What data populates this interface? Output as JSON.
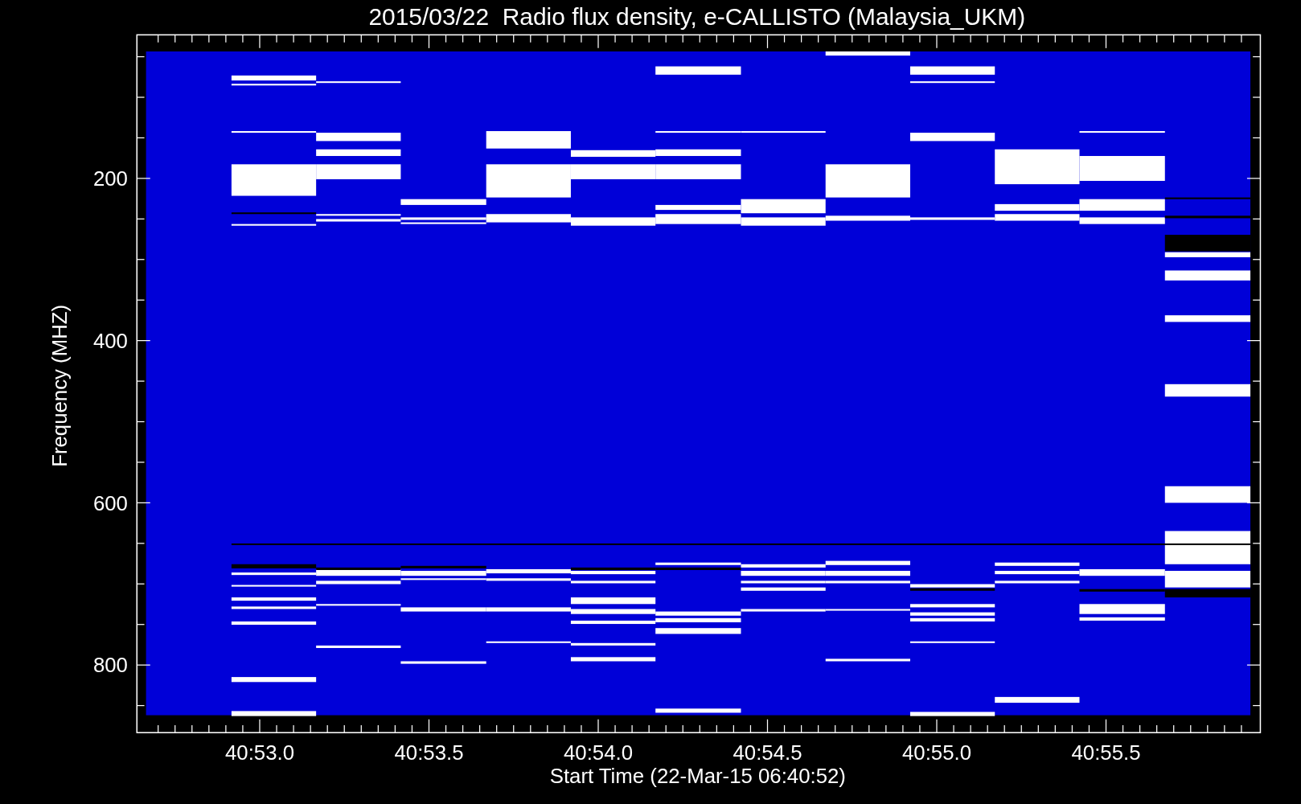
{
  "title": "2015/03/22  Radio flux density, e-CALLISTO (Malaysia_UKM)",
  "xlabel": "Start Time (22-Mar-15 06:40:52)",
  "ylabel": "Frequency (MHZ)",
  "yticks": [
    "200",
    "400",
    "600",
    "800"
  ],
  "xticks": [
    "40:53.0",
    "40:53.5",
    "40:54.0",
    "40:54.5",
    "40:55.0",
    "40:55.5"
  ]
}
